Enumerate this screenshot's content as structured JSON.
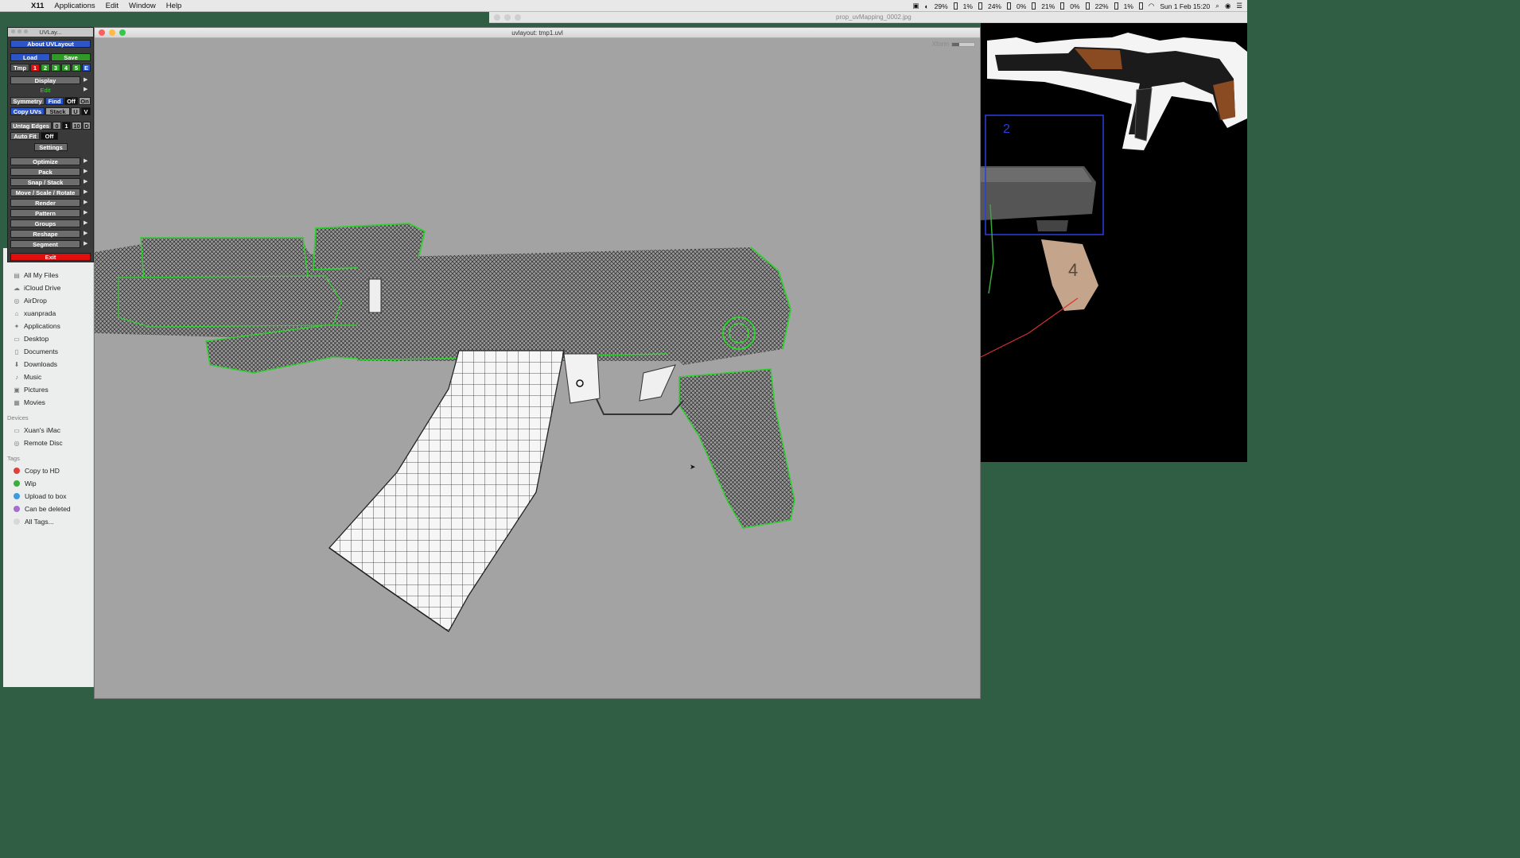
{
  "menubar": {
    "app_name": "X11",
    "items": [
      "Applications",
      "Edit",
      "Window",
      "Help"
    ],
    "status": {
      "readings": [
        "29%",
        "1%",
        "24%",
        "0%",
        "21%",
        "0%",
        "22%",
        "1%"
      ],
      "datetime": "Sun 1 Feb 15:20"
    }
  },
  "image_viewer": {
    "title": "prop_uvMapping_0002.jpg",
    "annotations": [
      "2",
      "4"
    ]
  },
  "uv_panel": {
    "title": "UVLay...",
    "about": "About UVLayout",
    "load": "Load",
    "save": "Save",
    "tmp": "Tmp",
    "slots": [
      "1",
      "2",
      "3",
      "4",
      "5",
      "E"
    ],
    "display": "Display",
    "edit": "Edit",
    "symmetry": "Symmetry",
    "find": "Find",
    "off": "Off",
    "on": "On",
    "copy_uvs": "Copy UVs",
    "stack": "Stack",
    "u": "U",
    "v": "V",
    "untag_edges": "Untag Edges",
    "edge_nums": [
      "0",
      "1",
      "10",
      "D"
    ],
    "auto_fit": "Auto Fit",
    "auto_fit_state": "Off",
    "settings": "Settings",
    "menu": [
      "Optimize",
      "Pack",
      "Snap / Stack",
      "Move / Scale / Rotate",
      "Render",
      "Pattern",
      "Groups",
      "Reshape",
      "Segment"
    ],
    "exit": "Exit"
  },
  "finder": {
    "favorites": [
      {
        "label": "All My Files",
        "icon": "all-files-icon"
      },
      {
        "label": "iCloud Drive",
        "icon": "cloud-icon"
      },
      {
        "label": "AirDrop",
        "icon": "airdrop-icon"
      },
      {
        "label": "xuanprada",
        "icon": "home-icon"
      },
      {
        "label": "Applications",
        "icon": "applications-icon"
      },
      {
        "label": "Desktop",
        "icon": "desktop-icon"
      },
      {
        "label": "Documents",
        "icon": "documents-icon"
      },
      {
        "label": "Downloads",
        "icon": "downloads-icon"
      },
      {
        "label": "Music",
        "icon": "music-icon"
      },
      {
        "label": "Pictures",
        "icon": "pictures-icon"
      },
      {
        "label": "Movies",
        "icon": "movies-icon"
      }
    ],
    "devices_header": "Devices",
    "devices": [
      {
        "label": "Xuan's iMac",
        "icon": "imac-icon"
      },
      {
        "label": "Remote Disc",
        "icon": "disc-icon"
      }
    ],
    "tags_header": "Tags",
    "tags": [
      {
        "label": "Copy to HD",
        "color": "#e0403c"
      },
      {
        "label": "Wip",
        "color": "#3cae3c"
      },
      {
        "label": "Upload to box",
        "color": "#3c9be0"
      },
      {
        "label": "Can be deleted",
        "color": "#a46fd1"
      },
      {
        "label": "All Tags...",
        "color": "#d8d8d8"
      }
    ]
  },
  "uv_window": {
    "title": "uvlayout: tmp1.uvl",
    "xform_label": "Xform"
  },
  "colors": {
    "desktop": "#2f5e45",
    "viewport": "#a3a3a3",
    "edge_highlight": "#2fd02f",
    "exit": "#e10e0e"
  }
}
